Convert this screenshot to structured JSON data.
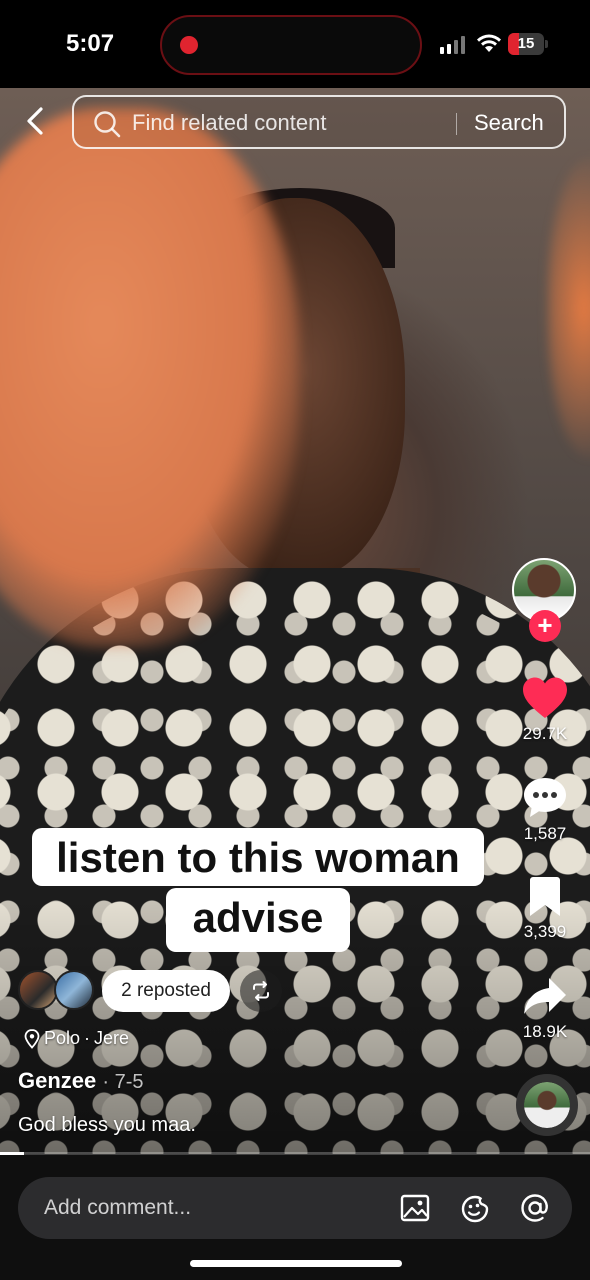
{
  "status_bar": {
    "time": "5:07",
    "battery_level": "15",
    "battery_fraction": 0.15,
    "recording_indicator_color": "#e0242f"
  },
  "search": {
    "placeholder": "Find related content",
    "button_label": "Search"
  },
  "caption": {
    "line1": "listen to this woman",
    "line2": "advise"
  },
  "actions": {
    "likes": "29.7K",
    "comments": "1,587",
    "saves": "3,399",
    "shares": "18.9K"
  },
  "repost": {
    "label": "2 reposted"
  },
  "meta": {
    "location_name": "Polo",
    "location_area": "Jere",
    "author": "Genzee",
    "date": "7-5",
    "description": "God bless you maa."
  },
  "progress": {
    "fraction": 0.04
  },
  "comment_bar": {
    "placeholder": "Add comment..."
  },
  "colors": {
    "like_red": "#fe2c55",
    "battery_red": "#e0242f"
  },
  "icons": [
    "back-chevron-icon",
    "search-icon",
    "heart-icon",
    "comment-bubble-icon",
    "bookmark-icon",
    "share-arrow-icon",
    "repost-icon",
    "location-pin-icon",
    "image-icon",
    "emoji-icon",
    "mention-icon"
  ]
}
